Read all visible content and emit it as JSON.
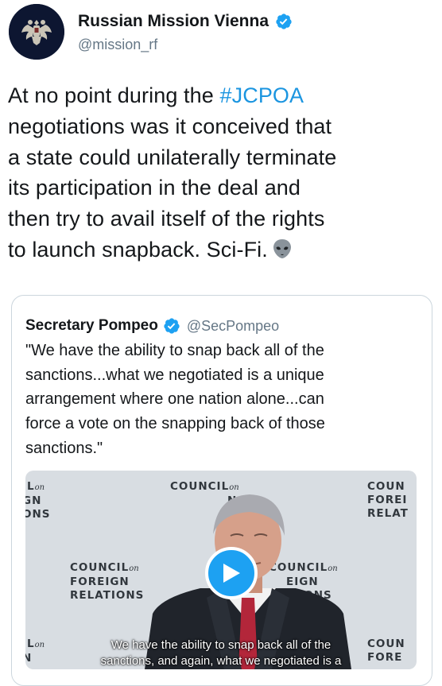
{
  "account": {
    "display_name": "Russian Mission Vienna",
    "handle": "@mission_rf",
    "verified_icon": "verified-badge-icon",
    "avatar_icon": "double-headed-eagle-emblem"
  },
  "tweet": {
    "lines": [
      {
        "before": "At no point during the ",
        "hashtag": "#JCPOA",
        "after": ""
      },
      {
        "before": "negotiations was it conceived that",
        "hashtag": "",
        "after": ""
      },
      {
        "before": "a state could unilaterally terminate",
        "hashtag": "",
        "after": ""
      },
      {
        "before": "its participation in the deal and",
        "hashtag": "",
        "after": ""
      },
      {
        "before": "then try to avail itself of the rights",
        "hashtag": "",
        "after": ""
      },
      {
        "before": "to launch snapback. Sci-Fi.",
        "hashtag": "",
        "after": ""
      }
    ],
    "emoji": "alien-emoji",
    "hashtag_color": "#1b95e0"
  },
  "quote": {
    "display_name": "Secretary Pompeo",
    "handle": "@SecPompeo",
    "lines": [
      "\"We have the ability to snap back all of the",
      "sanctions...what we negotiated is a unique",
      "arrangement where one nation alone...can",
      "force a vote on the snapping back of those",
      "sanctions.\""
    ]
  },
  "video": {
    "backdrop_logo": {
      "council": "COUNCIL",
      "on": "on",
      "foreign": "FOREIGN",
      "relations": "RELATIONS"
    },
    "logo_fragments": {
      "tl_1": "IL",
      "tl_on": "on",
      "tl_2": "GN",
      "tl_3": "ONS",
      "tc_1": "COUNCIL",
      "tc_on": "on",
      "tc_2": "N",
      "tc_3": "NS",
      "tr_1": "COUN",
      "tr_2": "FOREI",
      "tr_3": "RELAT",
      "ml_1": "COUNCIL",
      "ml_on": "on",
      "ml_2": "FOREIGN",
      "ml_3": "RELATIONS",
      "mr_1": "COUNCIL",
      "mr_on": "on",
      "mr_2": "EIGN",
      "mr_3": "TIONS",
      "bl_1": "IL",
      "bl_on": "on",
      "bl_2": "N",
      "br_1": "COUN",
      "br_2": "FORE"
    },
    "subtitle_lines": [
      "We have the ability to snap back all of the",
      "sanctions, and again, what we negotiated is a"
    ],
    "play_icon": "play-icon",
    "accent": "#1da1f2"
  }
}
